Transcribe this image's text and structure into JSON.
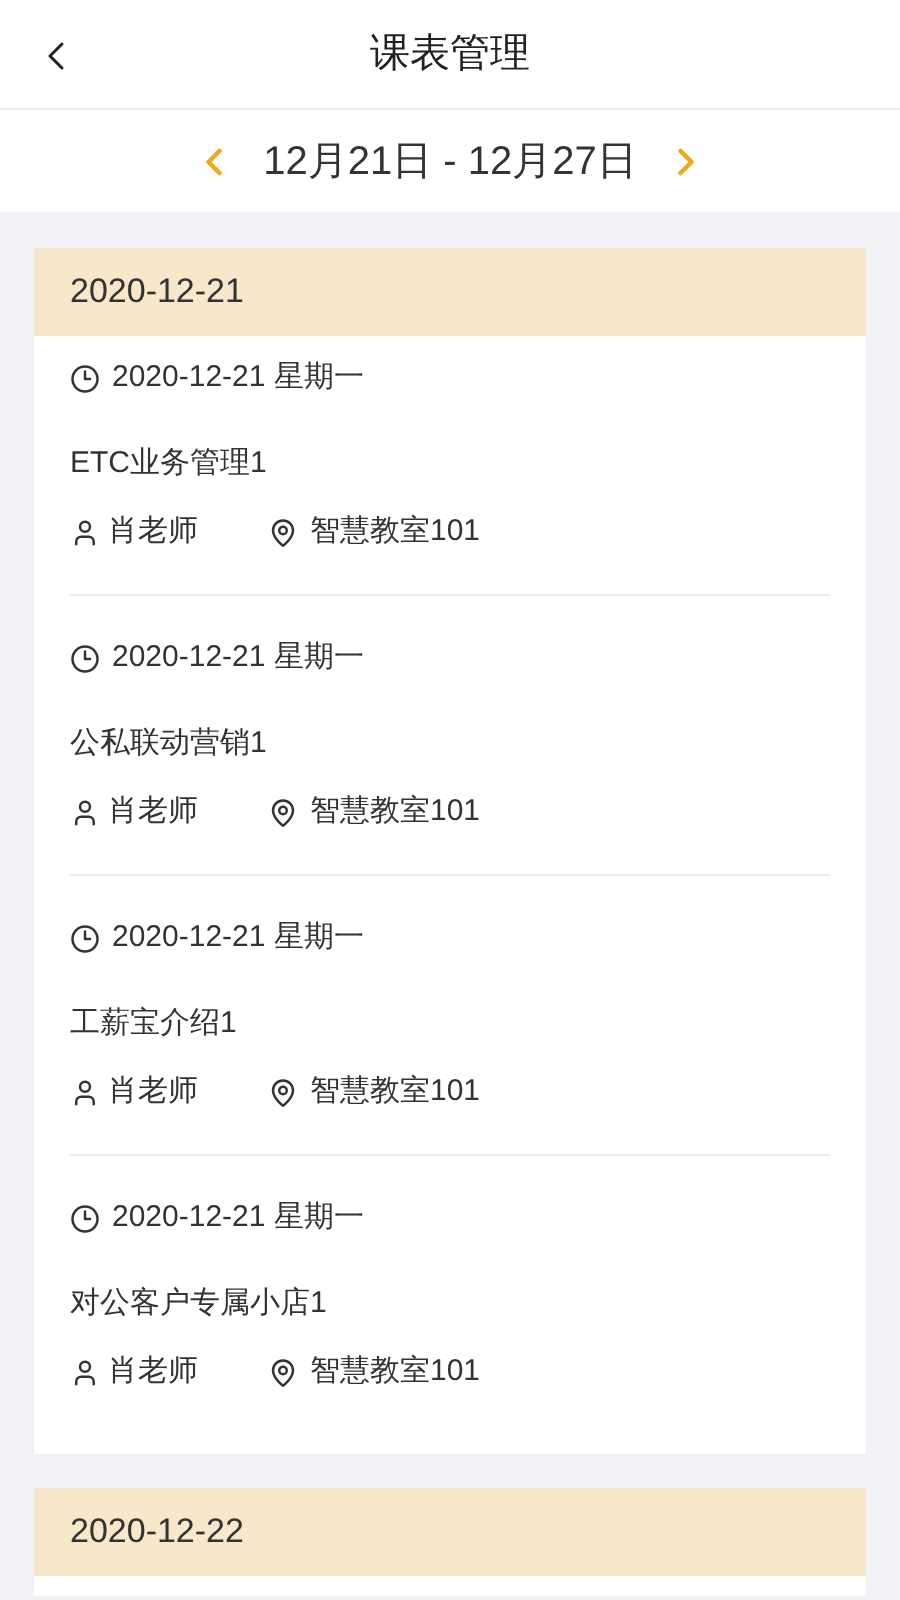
{
  "header": {
    "title": "课表管理"
  },
  "week": {
    "range": "12月21日 - 12月27日"
  },
  "days": [
    {
      "date": "2020-12-21",
      "lessons": [
        {
          "time": "2020-12-21 星期一",
          "name": "ETC业务管理1",
          "teacher": "肖老师",
          "room": "智慧教室101"
        },
        {
          "time": "2020-12-21 星期一",
          "name": "公私联动营销1",
          "teacher": "肖老师",
          "room": "智慧教室101"
        },
        {
          "time": "2020-12-21 星期一",
          "name": "工薪宝介绍1",
          "teacher": "肖老师",
          "room": "智慧教室101"
        },
        {
          "time": "2020-12-21 星期一",
          "name": "对公客户专属小店1",
          "teacher": "肖老师",
          "room": "智慧教室101"
        }
      ]
    },
    {
      "date": "2020-12-22"
    }
  ]
}
